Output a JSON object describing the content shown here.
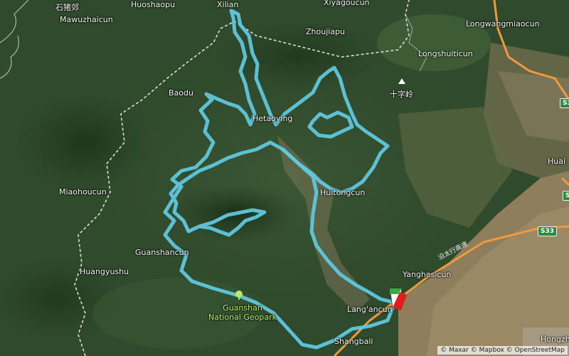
{
  "map": {
    "place_labels": [
      {
        "id": "shizhujiao",
        "text": "石猪郊"
      },
      {
        "id": "mawuzhaicun",
        "text": "Mawuzhaicun"
      },
      {
        "id": "huoshaopu",
        "text": "Huoshaopu"
      },
      {
        "id": "xilian",
        "text": "Xilian"
      },
      {
        "id": "xiyagoucun",
        "text": "Xiyagoucun"
      },
      {
        "id": "zhoujiapu",
        "text": "Zhoujiapu"
      },
      {
        "id": "longwangmiaocun",
        "text": "Longwangmiaocun"
      },
      {
        "id": "longshuiticun",
        "text": "Longshuiticun"
      },
      {
        "id": "baodu",
        "text": "Baodu"
      },
      {
        "id": "hetaoying",
        "text": "Hetaoying"
      },
      {
        "id": "shizi-ling",
        "text": "十字岭"
      },
      {
        "id": "huai",
        "text": "Huai"
      },
      {
        "id": "miaohoucun",
        "text": "Miaohoucun"
      },
      {
        "id": "huitongcun",
        "text": "Huitongcun"
      },
      {
        "id": "guanshancun",
        "text": "Guanshancun"
      },
      {
        "id": "huangyushu",
        "text": "Huangyushu"
      },
      {
        "id": "yanghesicun",
        "text": "Yanghesicun"
      },
      {
        "id": "langancun",
        "text": "Lang'ancun"
      },
      {
        "id": "shangbali",
        "text": "Shangbali"
      },
      {
        "id": "hongzh",
        "text": "Hongzh"
      }
    ],
    "park_label": "Guanshan\nNational Geopark",
    "highway_shields": [
      {
        "id": "s33-east",
        "text": "S33"
      },
      {
        "id": "s33-north",
        "text": "S3"
      },
      {
        "id": "s3-edge",
        "text": "S3"
      }
    ],
    "road_name": "沿太行高速",
    "attribution": "© Maxar © Mapbox © OpenStreetMap",
    "colors": {
      "route": "#5fc7de",
      "highway": "#ef9a3f",
      "boundary": "#d8d8d8",
      "marker_green": "#3aa845",
      "marker_red": "#e21d1d"
    }
  }
}
